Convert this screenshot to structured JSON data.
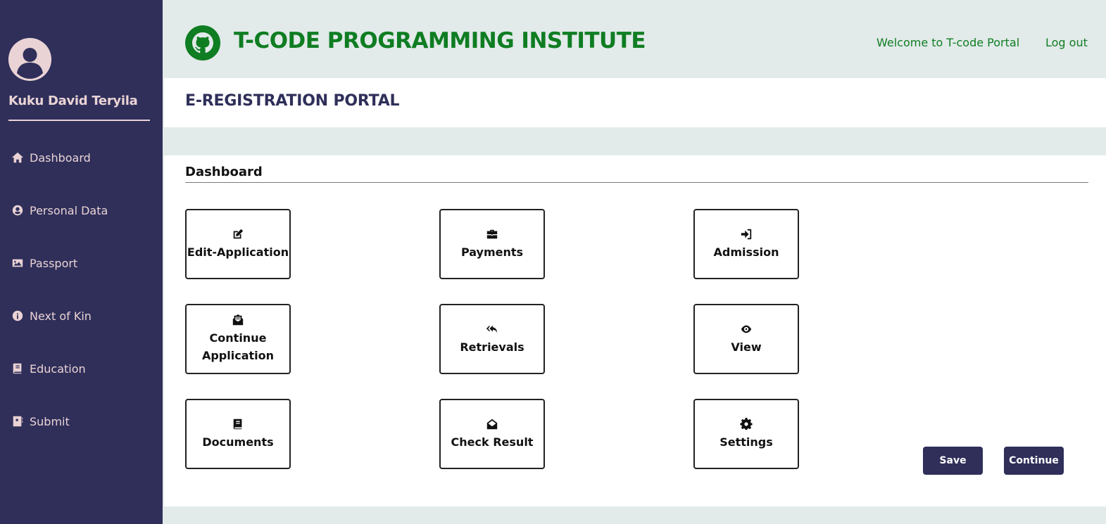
{
  "sidebar": {
    "user_name": "Kuku David Teryila",
    "items": [
      {
        "label": "Dashboard",
        "icon": "home-icon"
      },
      {
        "label": "Personal Data",
        "icon": "user-circle-icon"
      },
      {
        "label": "Passport",
        "icon": "image-icon"
      },
      {
        "label": "Next of Kin",
        "icon": "info-icon"
      },
      {
        "label": "Education",
        "icon": "book-icon"
      },
      {
        "label": "Submit",
        "icon": "address-book-icon"
      }
    ]
  },
  "header": {
    "title": "T-CODE PROGRAMMING INSTITUTE",
    "welcome": "Welcome to T-code Portal",
    "logout": "Log out",
    "brand_color": "#0f7d22",
    "logo_icon": "github-icon"
  },
  "portal": {
    "title": "E-REGISTRATION PORTAL"
  },
  "main": {
    "section_title": "Dashboard",
    "tiles": [
      {
        "label": "Edit-Application",
        "icon": "edit-icon"
      },
      {
        "label": "Payments",
        "icon": "briefcase-icon"
      },
      {
        "label": "Admission",
        "icon": "sign-in-icon"
      },
      {
        "label": "Continue\nApplication",
        "icon": "envelope-open-text-icon"
      },
      {
        "label": "Retrievals",
        "icon": "reply-all-icon"
      },
      {
        "label": "View",
        "icon": "eye-icon"
      },
      {
        "label": "Documents",
        "icon": "book-icon"
      },
      {
        "label": "Check Result",
        "icon": "envelope-open-icon"
      },
      {
        "label": "Settings",
        "icon": "cog-icon"
      }
    ],
    "save_label": "Save",
    "continue_label": "Continue"
  },
  "colors": {
    "sidebar_bg": "#2f2f5a",
    "sidebar_text": "#ead3d5",
    "page_bg": "#e2eaea",
    "button_bg": "#2f2f5a"
  }
}
